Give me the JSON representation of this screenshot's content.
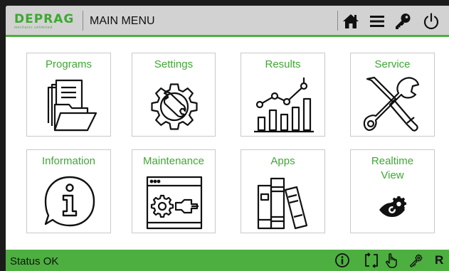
{
  "header": {
    "logo_name": "DEPRAG",
    "logo_tagline": "mechanic unlimited",
    "title": "MAIN MENU",
    "icons": [
      "home-icon",
      "menu-icon",
      "key-icon",
      "power-icon"
    ]
  },
  "tiles": [
    {
      "label": "Programs",
      "icon": "folder-documents-icon"
    },
    {
      "label": "Settings",
      "icon": "gear-wrench-icon"
    },
    {
      "label": "Results",
      "icon": "bar-line-chart-icon"
    },
    {
      "label": "Service",
      "icon": "screwdriver-wrench-icon"
    },
    {
      "label": "Information",
      "icon": "info-icon"
    },
    {
      "label": "Maintenance",
      "icon": "window-gear-wrench-icon"
    },
    {
      "label": "Apps",
      "icon": "books-icon"
    },
    {
      "label": "Realtime\nView",
      "label_line1": "Realtime",
      "label_line2": "View",
      "icon": "eye-gear-icon"
    }
  ],
  "statusbar": {
    "text": "Status OK",
    "icons": [
      "info-circle-icon",
      "cycle-icon",
      "hand-icon",
      "tools-icon"
    ],
    "mode_letter": "R"
  },
  "colors": {
    "accent": "#4caf3f",
    "label_green": "#3ea832",
    "header_bg": "#d2d2d2"
  }
}
